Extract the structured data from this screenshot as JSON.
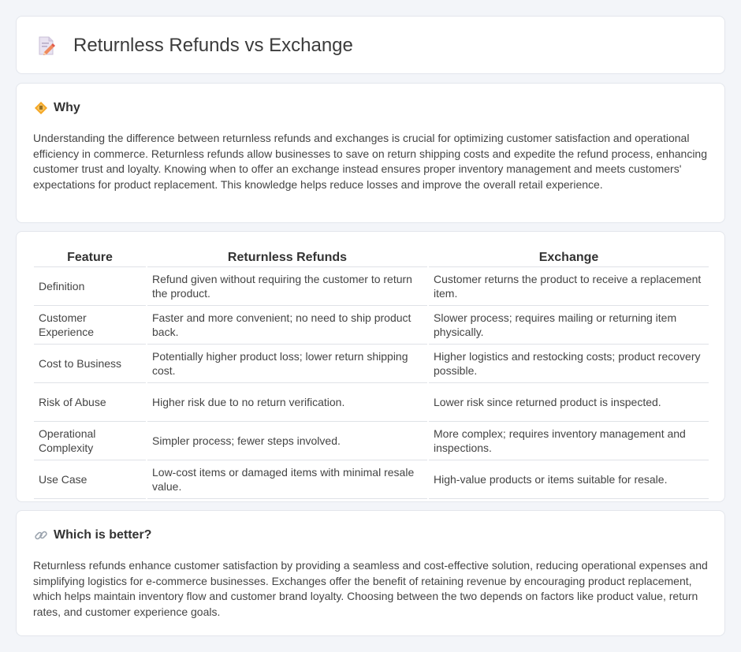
{
  "page": {
    "title": "Returnless Refunds vs Exchange",
    "title_icon": "document-edit-icon"
  },
  "why": {
    "icon": "diamond-warning-icon",
    "heading": "Why",
    "body": "Understanding the difference between returnless refunds and exchanges is crucial for optimizing customer satisfaction and operational efficiency in commerce. Returnless refunds allow businesses to save on return shipping costs and expedite the refund process, enhancing customer trust and loyalty. Knowing when to offer an exchange instead ensures proper inventory management and meets customers' expectations for product replacement. This knowledge helps reduce losses and improve the overall retail experience."
  },
  "comparison": {
    "headers": [
      "Feature",
      "Returnless Refunds",
      "Exchange"
    ],
    "rows": [
      [
        "Definition",
        "Refund given without requiring the customer to return the product.",
        "Customer returns the product to receive a replacement item."
      ],
      [
        "Customer Experience",
        "Faster and more convenient; no need to ship product back.",
        "Slower process; requires mailing or returning item physically."
      ],
      [
        "Cost to Business",
        "Potentially higher product loss; lower return shipping cost.",
        "Higher logistics and restocking costs; product recovery possible."
      ],
      [
        "Risk of Abuse",
        "Higher risk due to no return verification.",
        "Lower risk since returned product is inspected."
      ],
      [
        "Operational Complexity",
        "Simpler process; fewer steps involved.",
        "More complex; requires inventory management and inspections."
      ],
      [
        "Use Case",
        "Low-cost items or damaged items with minimal resale value.",
        "High-value products or items suitable for resale."
      ]
    ]
  },
  "better": {
    "icon": "link-icon",
    "heading": "Which is better?",
    "body": "Returnless refunds enhance customer satisfaction by providing a seamless and cost-effective solution, reducing operational expenses and simplifying logistics for e-commerce businesses. Exchanges offer the benefit of retaining revenue by encouraging product replacement, which helps maintain inventory flow and customer brand loyalty. Choosing between the two depends on factors like product value, return rates, and customer experience goals."
  }
}
